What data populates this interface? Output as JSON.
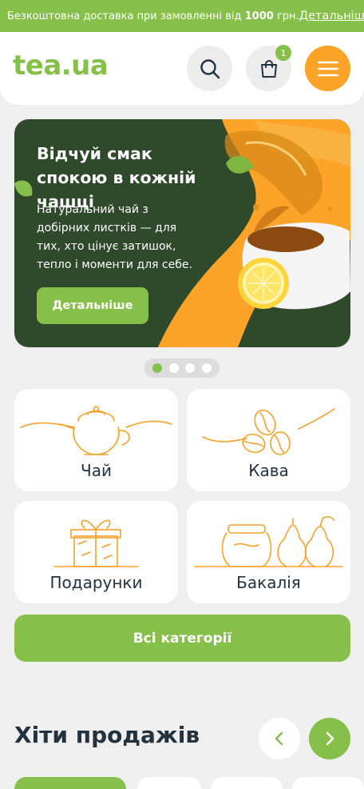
{
  "promo": {
    "text_before": "Безкоштовна доставка при замовленні від ",
    "amount": "1000",
    "text_after": " грн.",
    "more_link": "Детальніше"
  },
  "header": {
    "logo": "tea.ua",
    "cart_count": "1",
    "icons": {
      "search": "search-icon",
      "cart": "shopping-bag-icon",
      "menu": "hamburger-menu-icon"
    }
  },
  "hero": {
    "title": "Відчуй смак спокою в кожній чашці",
    "text": "Натуральний чай з добірних листків — для тих, хто цінує затишок, тепло і моменти для себе.",
    "button": "Детальніше",
    "slides": 4,
    "active_slide": 1
  },
  "categories": [
    {
      "label": "Чай",
      "icon": "teapot-icon"
    },
    {
      "label": "Кава",
      "icon": "coffee-beans-icon"
    },
    {
      "label": "Подарунки",
      "icon": "gift-box-icon"
    },
    {
      "label": "Бакалія",
      "icon": "jar-and-pears-icon"
    }
  ],
  "all_categories_button": "Всі категорії",
  "bestsellers": {
    "title": "Хіти продажів",
    "tabs": [
      "",
      "",
      "",
      ""
    ]
  },
  "colors": {
    "accent_green": "#86c04a",
    "accent_orange": "#fca328",
    "hero_bg": "#2f4a2a",
    "text_dark": "#23323f"
  }
}
